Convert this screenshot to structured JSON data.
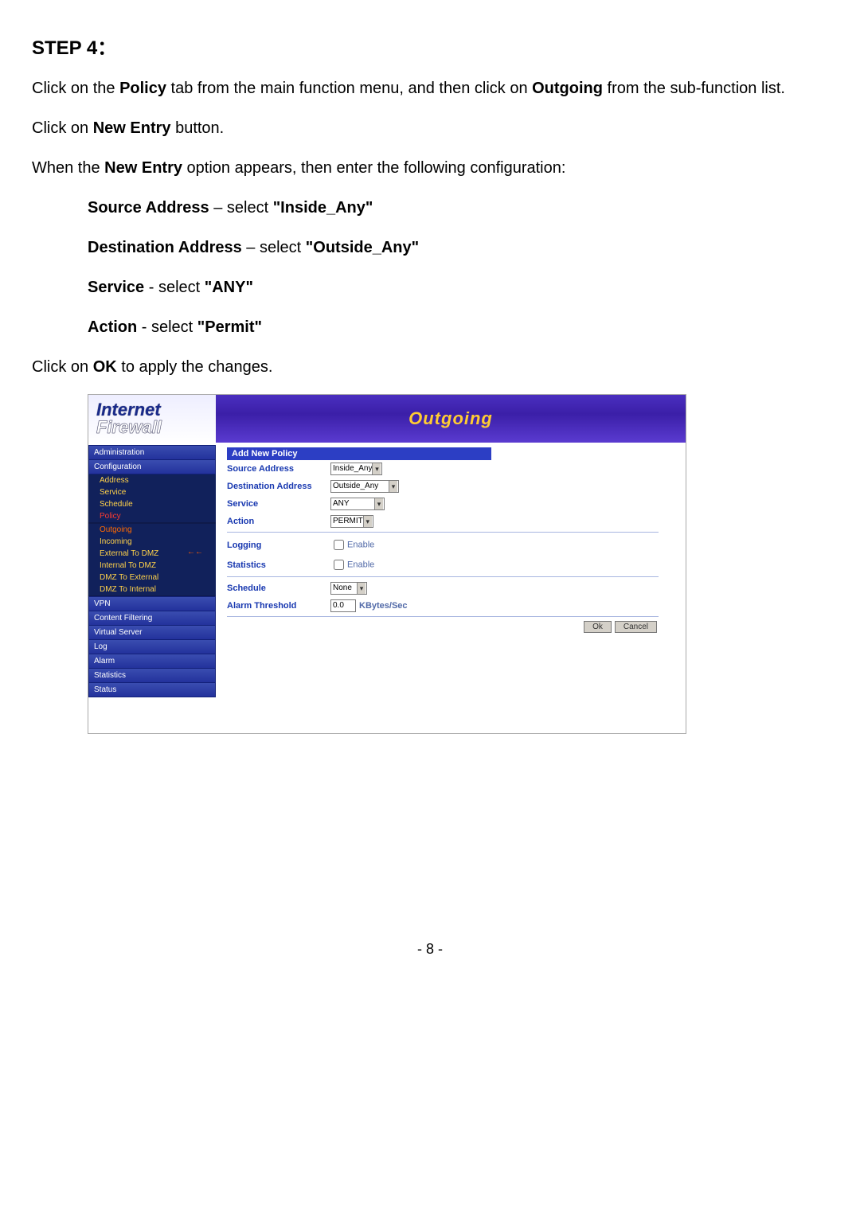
{
  "step_title": "STEP 4：",
  "p1a": "Click on the ",
  "p1b": "Policy",
  "p1c": " tab from the main function menu, and then click on ",
  "p1d": "Outgoing",
  "p1e": " from the sub-function list.",
  "p2a": "Click on ",
  "p2b": "New Entry",
  "p2c": " button.",
  "p3a": "When the ",
  "p3b": "New Entry",
  "p3c": " option appears, then enter the following configuration:",
  "cfg": {
    "src_l": "Source Address",
    "src_m": " – select ",
    "src_v": "\"Inside_Any\"",
    "dst_l": "Destination Address",
    "dst_m": " – select ",
    "dst_v": "\"Outside_Any\"",
    "svc_l": "Service",
    "svc_m": " - select ",
    "svc_v": "\"ANY\"",
    "act_l": "Action",
    "act_m": " -  select   ",
    "act_v": "\"Permit\""
  },
  "p4a": "Click on ",
  "p4b": "OK",
  "p4c": " to apply the changes.",
  "brand1": "Internet",
  "brand2": "Firewall",
  "title": "Outgoing",
  "side": {
    "admin": "Administration",
    "config": "Configuration",
    "address": "Address",
    "service": "Service",
    "schedule": "Schedule",
    "policy": "Policy",
    "outgoing": "Outgoing",
    "incoming": "Incoming",
    "ext_to_dmz": "External To DMZ",
    "int_to_dmz": "Internal To DMZ",
    "dmz_to_ext": "DMZ To External",
    "dmz_to_int": "DMZ To Internal",
    "vpn": "VPN",
    "content": "Content Filtering",
    "vserver": "Virtual Server",
    "log": "Log",
    "alarm": "Alarm",
    "stats": "Statistics",
    "status": "Status"
  },
  "arrows": "←←",
  "form": {
    "head": "Add New Policy",
    "src": "Source Address",
    "src_v": "Inside_Any",
    "dst": "Destination Address",
    "dst_v": "Outside_Any",
    "svc": "Service",
    "svc_v": "ANY",
    "act": "Action",
    "act_v": "PERMIT",
    "logging": "Logging",
    "enable": "Enable",
    "stats": "Statistics",
    "sched": "Schedule",
    "sched_v": "None",
    "alarm": "Alarm Threshold",
    "alarm_v": "0.0",
    "unit": "KBytes/Sec",
    "ok": "Ok",
    "cancel": "Cancel"
  },
  "page_no": "- 8 -"
}
